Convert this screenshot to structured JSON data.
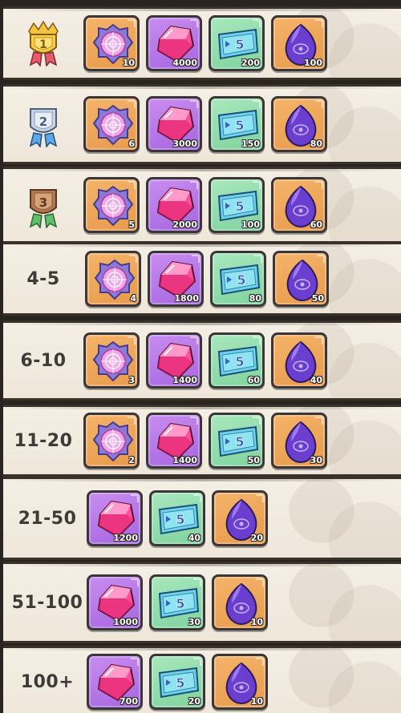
{
  "colors": {
    "frame": "#3a3536",
    "orange_tile": "#ee9f55",
    "purple_tile": "#b775e6",
    "green_tile": "#8fdcad",
    "rank_text": "#3d3a38"
  },
  "rows": [
    {
      "rank_icon": "gold-medal-1",
      "rank": "1",
      "items": [
        {
          "icon": "summon-crest-icon",
          "qty": "10"
        },
        {
          "icon": "pink-gem-icon",
          "qty": "4000"
        },
        {
          "icon": "5min-ticket-icon",
          "qty": "200"
        },
        {
          "icon": "purple-egg-icon",
          "qty": "100"
        }
      ]
    },
    {
      "rank_icon": "silver-medal-2",
      "rank": "2",
      "items": [
        {
          "icon": "summon-crest-icon",
          "qty": "6"
        },
        {
          "icon": "pink-gem-icon",
          "qty": "3000"
        },
        {
          "icon": "5min-ticket-icon",
          "qty": "150"
        },
        {
          "icon": "purple-egg-icon",
          "qty": "80"
        }
      ]
    },
    {
      "rank_icon": "bronze-medal-3",
      "rank": "3",
      "items": [
        {
          "icon": "summon-crest-icon",
          "qty": "5"
        },
        {
          "icon": "pink-gem-icon",
          "qty": "2000"
        },
        {
          "icon": "5min-ticket-icon",
          "qty": "100"
        },
        {
          "icon": "purple-egg-icon",
          "qty": "60"
        }
      ]
    },
    {
      "rank_text": "4-5",
      "items": [
        {
          "icon": "summon-crest-icon",
          "qty": "4"
        },
        {
          "icon": "pink-gem-icon",
          "qty": "1800"
        },
        {
          "icon": "5min-ticket-icon",
          "qty": "80"
        },
        {
          "icon": "purple-egg-icon",
          "qty": "50"
        }
      ]
    },
    {
      "rank_text": "6-10",
      "items": [
        {
          "icon": "summon-crest-icon",
          "qty": "3"
        },
        {
          "icon": "pink-gem-icon",
          "qty": "1400"
        },
        {
          "icon": "5min-ticket-icon",
          "qty": "60"
        },
        {
          "icon": "purple-egg-icon",
          "qty": "40"
        }
      ]
    },
    {
      "rank_text": "11-20",
      "items": [
        {
          "icon": "summon-crest-icon",
          "qty": "2"
        },
        {
          "icon": "pink-gem-icon",
          "qty": "1400"
        },
        {
          "icon": "5min-ticket-icon",
          "qty": "50"
        },
        {
          "icon": "purple-egg-icon",
          "qty": "30"
        }
      ]
    },
    {
      "rank_text": "21-50",
      "items": [
        {
          "icon": "pink-gem-icon",
          "qty": "1200"
        },
        {
          "icon": "5min-ticket-icon",
          "qty": "40"
        },
        {
          "icon": "purple-egg-icon",
          "qty": "20"
        }
      ]
    },
    {
      "rank_text": "51-100",
      "items": [
        {
          "icon": "pink-gem-icon",
          "qty": "1000"
        },
        {
          "icon": "5min-ticket-icon",
          "qty": "30"
        },
        {
          "icon": "purple-egg-icon",
          "qty": "10"
        }
      ]
    },
    {
      "rank_text": "100+",
      "items": [
        {
          "icon": "pink-gem-icon",
          "qty": "700"
        },
        {
          "icon": "5min-ticket-icon",
          "qty": "20"
        },
        {
          "icon": "purple-egg-icon",
          "qty": "10"
        }
      ]
    }
  ]
}
